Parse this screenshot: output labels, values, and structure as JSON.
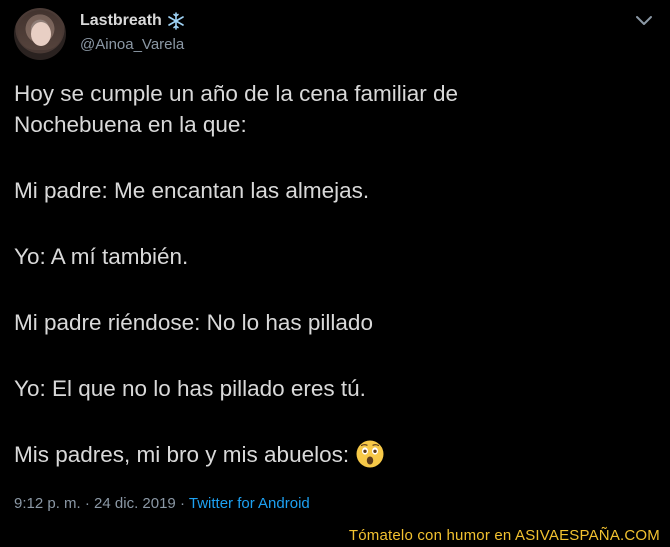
{
  "user": {
    "display_name": "Lastbreath",
    "handle": "@Ainoa_Varela",
    "badge_icon": "snowflake-icon"
  },
  "tweet": {
    "lines": [
      "Hoy se cumple un año de la cena familiar de",
      "Nochebuena en la que:",
      "Mi padre: Me encantan las almejas.",
      "Yo: A mí también.",
      "Mi padre riéndose: No lo has pillado",
      "Yo: El que no lo has pillado eres tú.",
      "Mis padres, mi bro y mis abuelos:"
    ],
    "emoji": "astonished-face-icon"
  },
  "meta": {
    "time": "9:12 p. m.",
    "separator": "·",
    "date": "24 dic. 2019",
    "source": "Twitter for Android"
  },
  "footer": {
    "text": "Tómatelo con humor en ASIVAESPAÑA.COM"
  },
  "colors": {
    "background": "#000000",
    "text": "#d9d9d9",
    "secondary": "#8b98a5",
    "link": "#1da1f2",
    "footer": "#f2c230"
  }
}
